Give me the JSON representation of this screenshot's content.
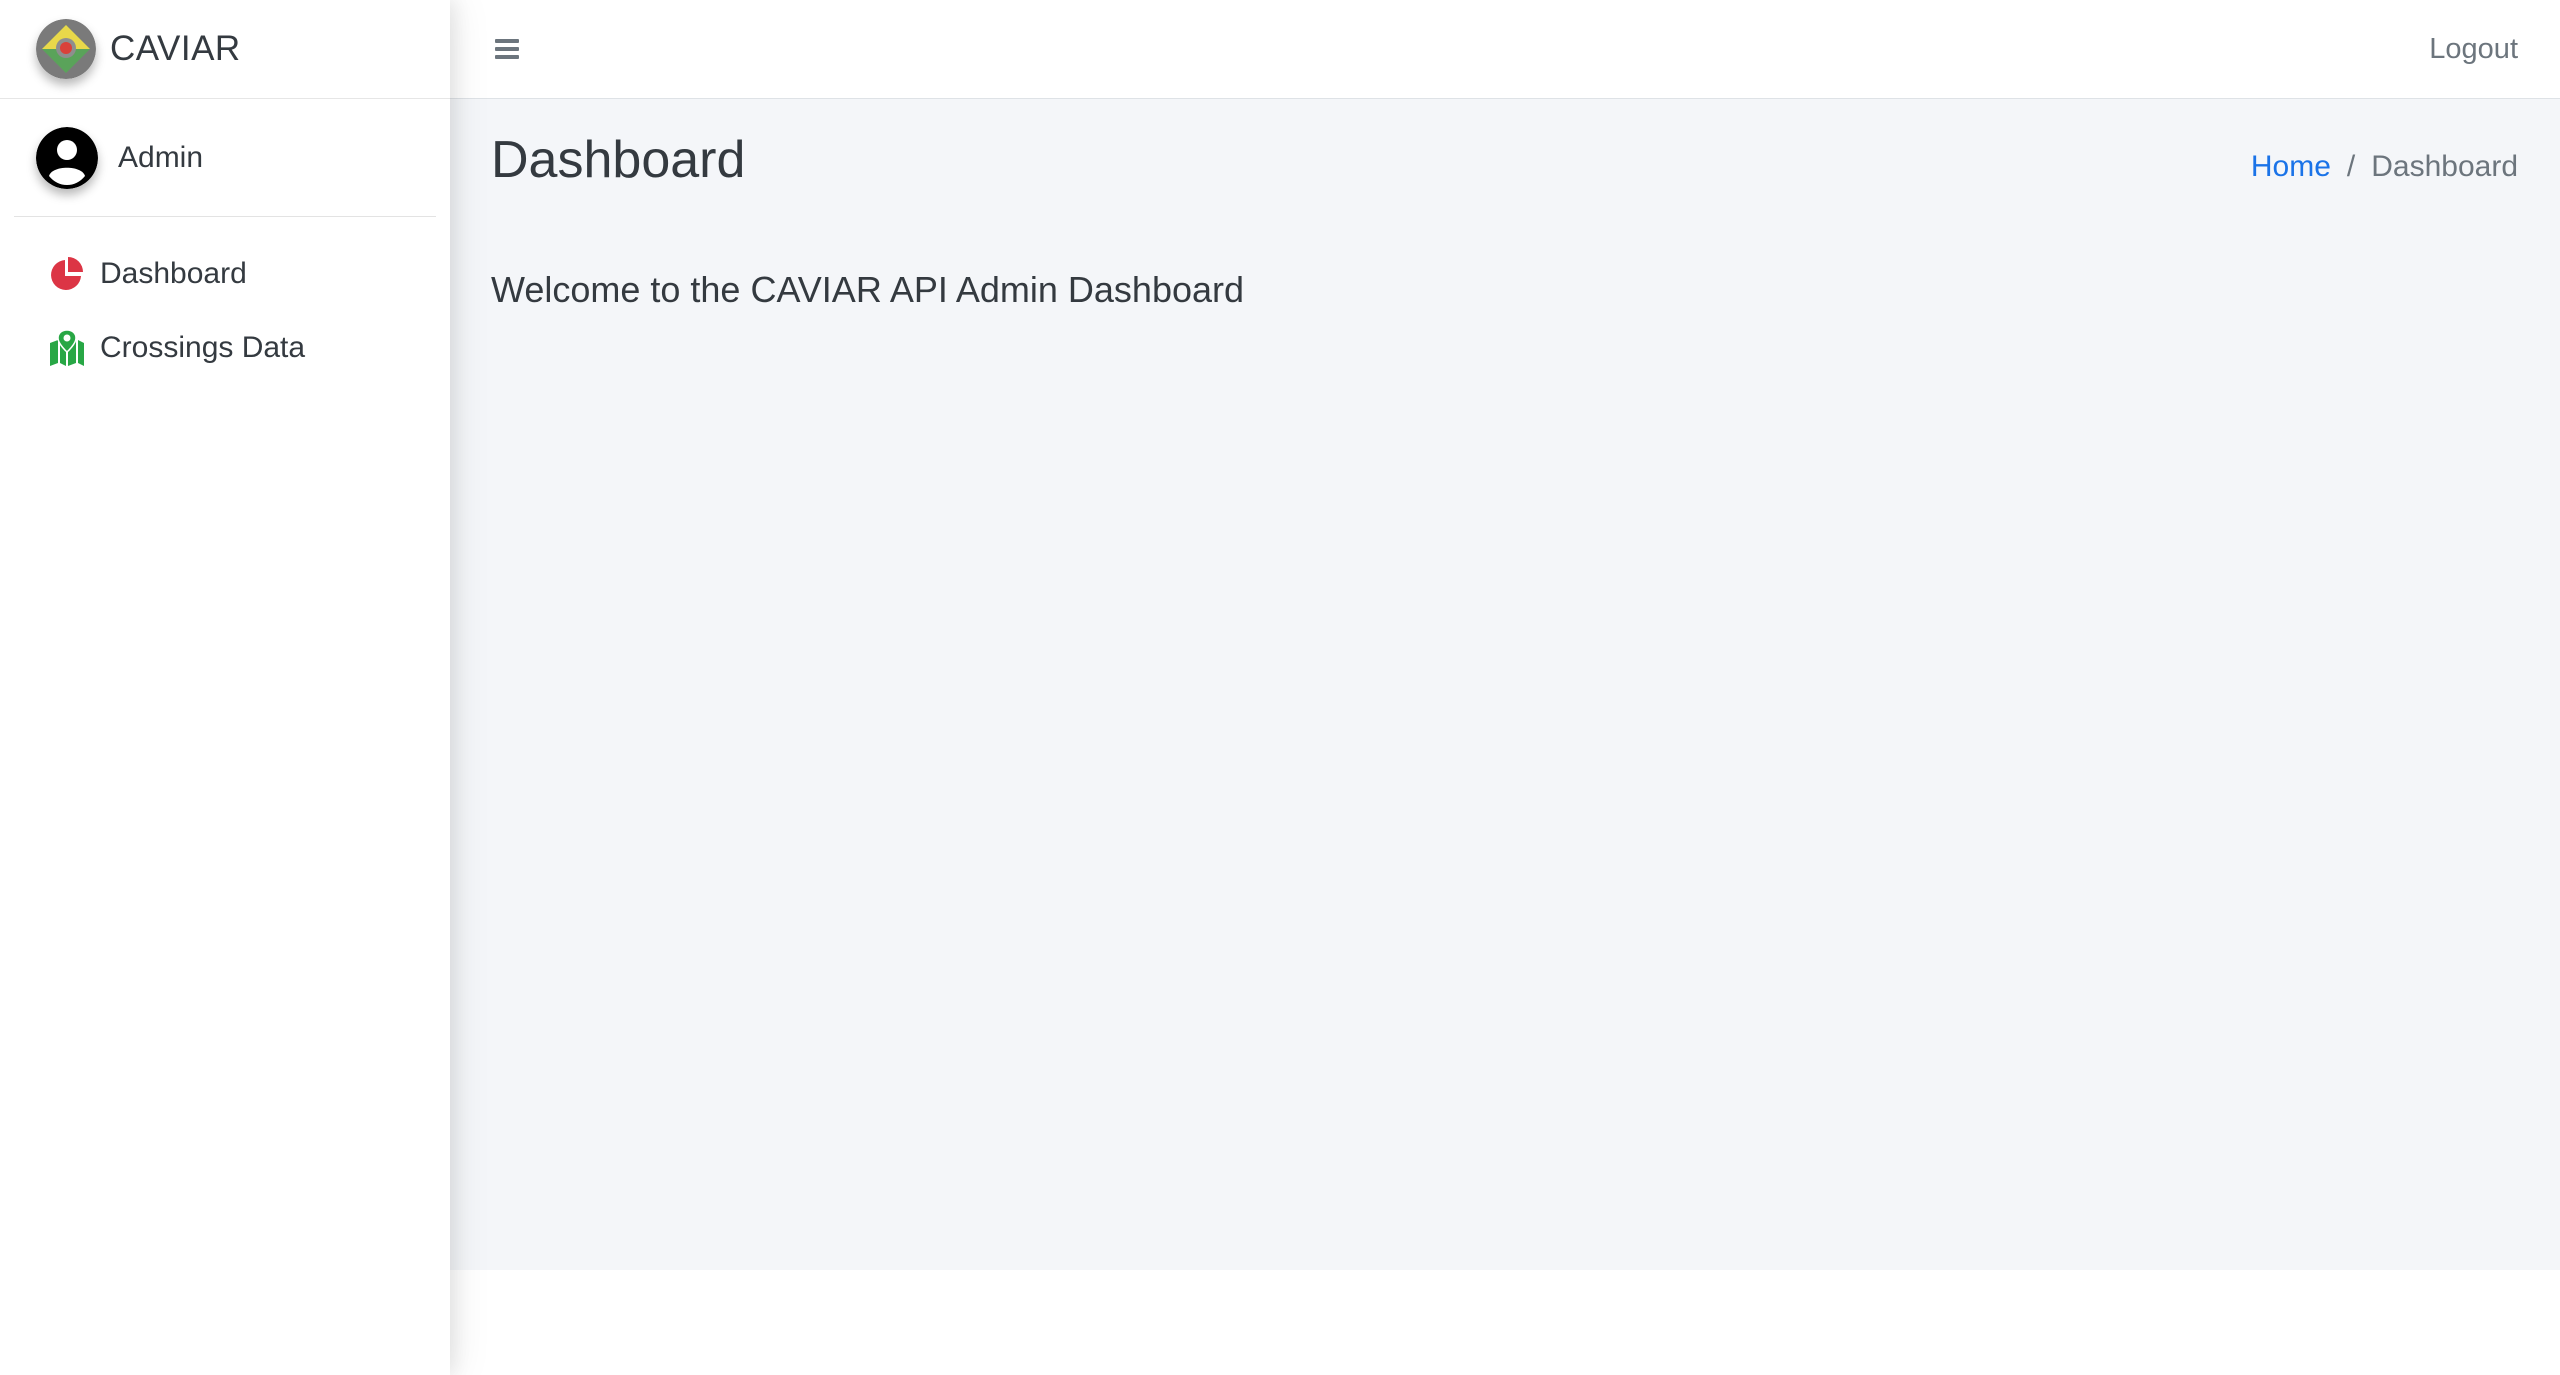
{
  "brand": {
    "name": "CAVIAR",
    "logo_icon": "caviar-logo"
  },
  "user": {
    "name": "Admin",
    "avatar_icon": "user-circle-icon"
  },
  "sidebar": {
    "items": [
      {
        "label": "Dashboard",
        "icon": "chart-pie-icon",
        "icon_color": "#dc3545"
      },
      {
        "label": "Crossings Data",
        "icon": "map-location-icon",
        "icon_color": "#28a745"
      }
    ]
  },
  "topbar": {
    "menu_icon": "hamburger-icon",
    "logout_label": "Logout"
  },
  "content": {
    "title": "Dashboard",
    "breadcrumb": {
      "home": "Home",
      "separator": "/",
      "current": "Dashboard"
    },
    "welcome": "Welcome to the CAVIAR API Admin Dashboard"
  },
  "colors": {
    "content_bg": "#f4f6f9",
    "link": "#1a73e8",
    "text": "#343a40",
    "muted": "#6c757d"
  }
}
